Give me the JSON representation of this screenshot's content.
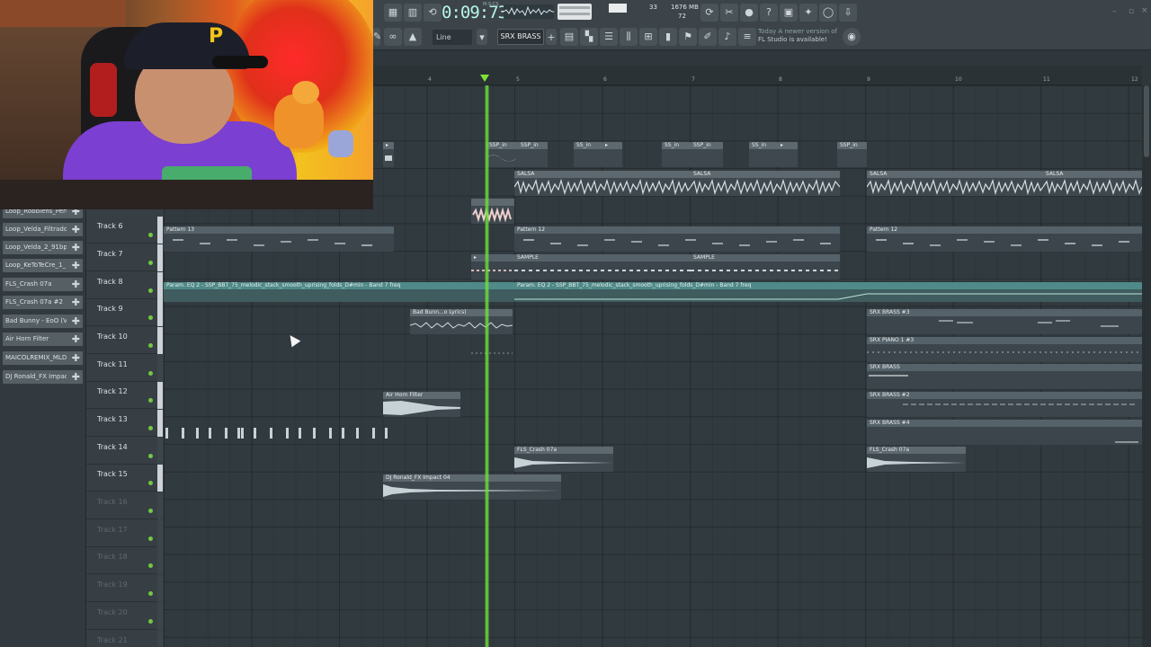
{
  "toolbar": {
    "time": "0:09:73",
    "time_unit": "M:S:CS",
    "cpu": "33",
    "memory": "1676 MB",
    "polyphony": "72",
    "snap": "Line",
    "pattern": "SRX BRASS",
    "update_line1": "Today  A newer version of",
    "update_line2": "FL Studio is available!"
  },
  "timeline": {
    "bars": [
      "4",
      "5",
      "6",
      "7",
      "8",
      "9",
      "10",
      "11",
      "12"
    ]
  },
  "browser": {
    "items": [
      "Loop_Robbiefis_Pert...",
      "Loop_Velda_Filtrado...",
      "Loop_Velda_2_91bp...",
      "Loop_KeToTeCre_1_1...",
      "FLS_Crash 07a",
      "FLS_Crash 07a #2",
      "Bad Bunny - EoO (Vi...",
      "Air Horn Filter",
      "MAICOLREMIX_MLD_G...",
      "DJ Ronald_FX Impact..."
    ]
  },
  "tracks": [
    "Track 6",
    "Track 7",
    "Track 8",
    "Track 9",
    "Track 10",
    "Track 11",
    "Track 12",
    "Track 13",
    "Track 14",
    "Track 15",
    "Track 16",
    "Track 17",
    "Track 18",
    "Track 19",
    "Track 20",
    "Track 21"
  ],
  "clips": {
    "ssp1": "SSP_in",
    "ssp2": "SSP_in",
    "ssp3": "SS_in",
    "ssp4": "SS_in",
    "ssp5": "SSP_in",
    "ssp6": "SS_in",
    "ssp7": "SSP_in",
    "salsa1": "SALSA",
    "salsa2": "SALSA",
    "salsa3": "SALSA",
    "salsa4": "SALSA",
    "pattern13": "Pattern 13",
    "pattern12a": "Pattern 12",
    "pattern12b": "Pattern 12",
    "sample1": "SAMPLE",
    "sample2": "SAMPLE",
    "param1": "Param. EQ 2 - SSP_BBT_75_melodic_stack_smooth_uprising_folds_D#min - Band 7 freq",
    "param2": "Param. EQ 2 - SSP_BBT_75_melodic_stack_smooth_uprising_folds_D#min - Band 7 freq",
    "badbunny": "Bad Bunn...o Lyrics)",
    "srxbrass3": "SRX BRASS #3",
    "srxpiano": "SRX PIANO 1 #3",
    "srxbrass": "SRX BRASS",
    "airhorn": "Air Horn Filter",
    "srxbrass2": "SRX BRASS #2",
    "srxbrass4": "SRX BRASS #4",
    "crash1": "FLS_Crash 07a",
    "crash2": "FLS_Crash 07a",
    "djronald": "DJ Ronald_FX Impact 04"
  },
  "colors": {
    "accent_playhead": "#6fe13a",
    "grip_active": "#ccd2d5",
    "automation_clip": "#4f8a88",
    "led": "#73c843"
  }
}
